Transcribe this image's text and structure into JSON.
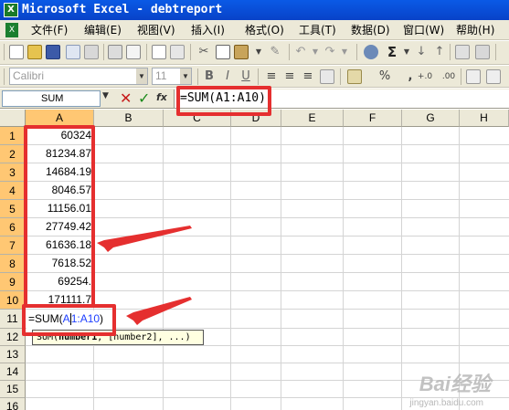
{
  "window": {
    "title": "Microsoft Excel - debtreport"
  },
  "menu": [
    "文件(F)",
    "编辑(E)",
    "视图(V)",
    "插入(I)",
    "格式(O)",
    "工具(T)",
    "数据(D)",
    "窗口(W)",
    "帮助(H)"
  ],
  "format_toolbar": {
    "font_name": "Calibri",
    "font_size": "11",
    "percent": "%",
    "comma": ","
  },
  "std_toolbar": {
    "sum_symbol": "Σ"
  },
  "formula_bar": {
    "name_box": "SUM",
    "fx": "fx",
    "cancel": "✕",
    "enter": "✓",
    "content": "=SUM(A1:A10)"
  },
  "columns": [
    "A",
    "B",
    "C",
    "D",
    "E",
    "F",
    "G",
    "H"
  ],
  "rows": [
    "1",
    "2",
    "3",
    "4",
    "5",
    "6",
    "7",
    "8",
    "9",
    "10",
    "11",
    "12",
    "13",
    "14",
    "15",
    "16"
  ],
  "cells_a": [
    "60324",
    "81234.87",
    "14684.19",
    "8046.57",
    "11156.01",
    "27749.42",
    "61636.18",
    "7618.52",
    "69254.",
    "171111.7"
  ],
  "editing_cell": {
    "prefix": "=SUM(",
    "ref_a": "A",
    "ref_b": "1:A10",
    "suffix": ")"
  },
  "tooltip": {
    "fn": "SUM",
    "bold_arg": "number1",
    "rest": ", [number2], ...)"
  },
  "watermark": {
    "logo": "Bai经验",
    "sub": "jingyan.baidu.com"
  },
  "colors": {
    "title_bar": "#0a5ae6",
    "annotation_red": "#e52f2f",
    "header_highlight": "#ffc773"
  }
}
